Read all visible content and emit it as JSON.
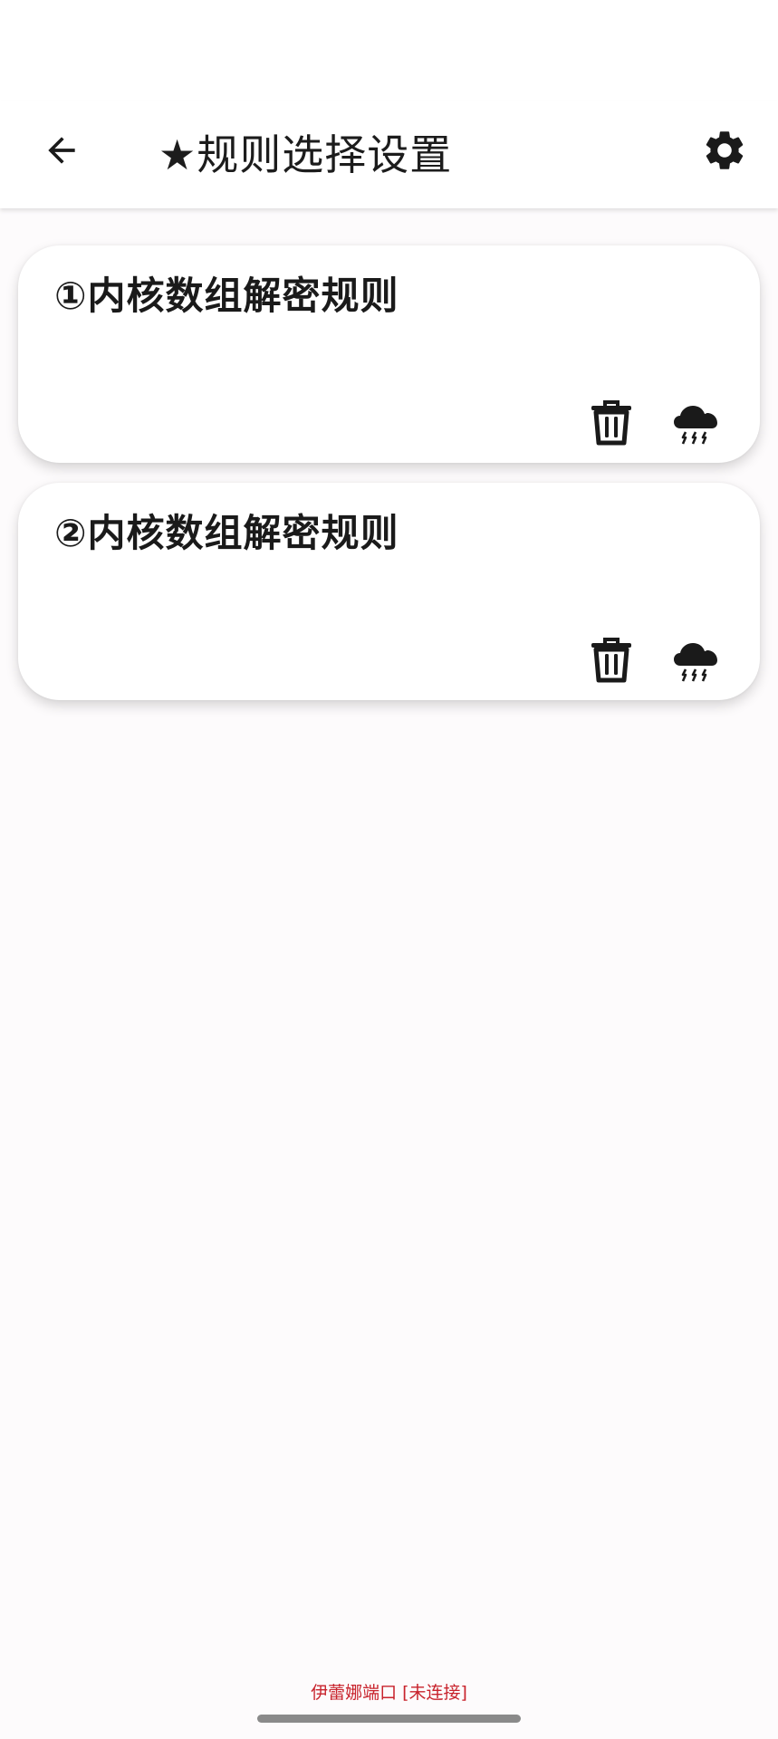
{
  "header": {
    "title": "★规则选择设置"
  },
  "rules": [
    {
      "title": "①内核数组解密规则"
    },
    {
      "title": "②内核数组解密规则"
    }
  ],
  "footer": {
    "status": "伊蕾娜端口 [未连接]"
  },
  "icons": {
    "back": "arrow-back-icon",
    "settings": "gear-icon",
    "delete": "trash-icon",
    "cloud": "thunderstorm-cloud-icon"
  },
  "colors": {
    "background": "#fdfbfc",
    "card": "#ffffff",
    "text": "#1a1a1a",
    "status_text": "#c8232c"
  }
}
